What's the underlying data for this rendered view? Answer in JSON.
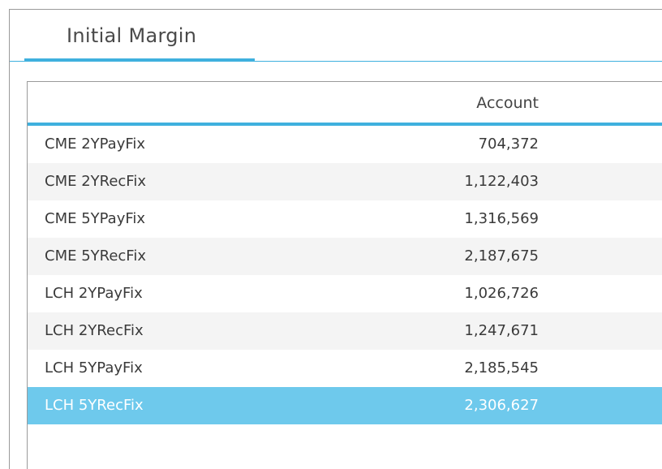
{
  "tabs": [
    {
      "label": "Initial Margin",
      "active": true
    }
  ],
  "grid": {
    "columns": [
      "",
      "Account"
    ],
    "rows": [
      {
        "name": "CME 2YPayFix",
        "account": "704,372"
      },
      {
        "name": "CME 2YRecFix",
        "account": "1,122,403"
      },
      {
        "name": "CME 5YPayFix",
        "account": "1,316,569"
      },
      {
        "name": "CME 5YRecFix",
        "account": "2,187,675"
      },
      {
        "name": "LCH 2YPayFix",
        "account": "1,026,726"
      },
      {
        "name": "LCH 2YRecFix",
        "account": "1,247,671"
      },
      {
        "name": "LCH 5YPayFix",
        "account": "2,185,545"
      },
      {
        "name": "LCH 5YRecFix",
        "account": "2,306,627",
        "selected": true
      }
    ]
  },
  "colors": {
    "accent": "#3fb0de",
    "selected_row": "#6ec9ec",
    "alt_row": "#f4f4f4"
  }
}
